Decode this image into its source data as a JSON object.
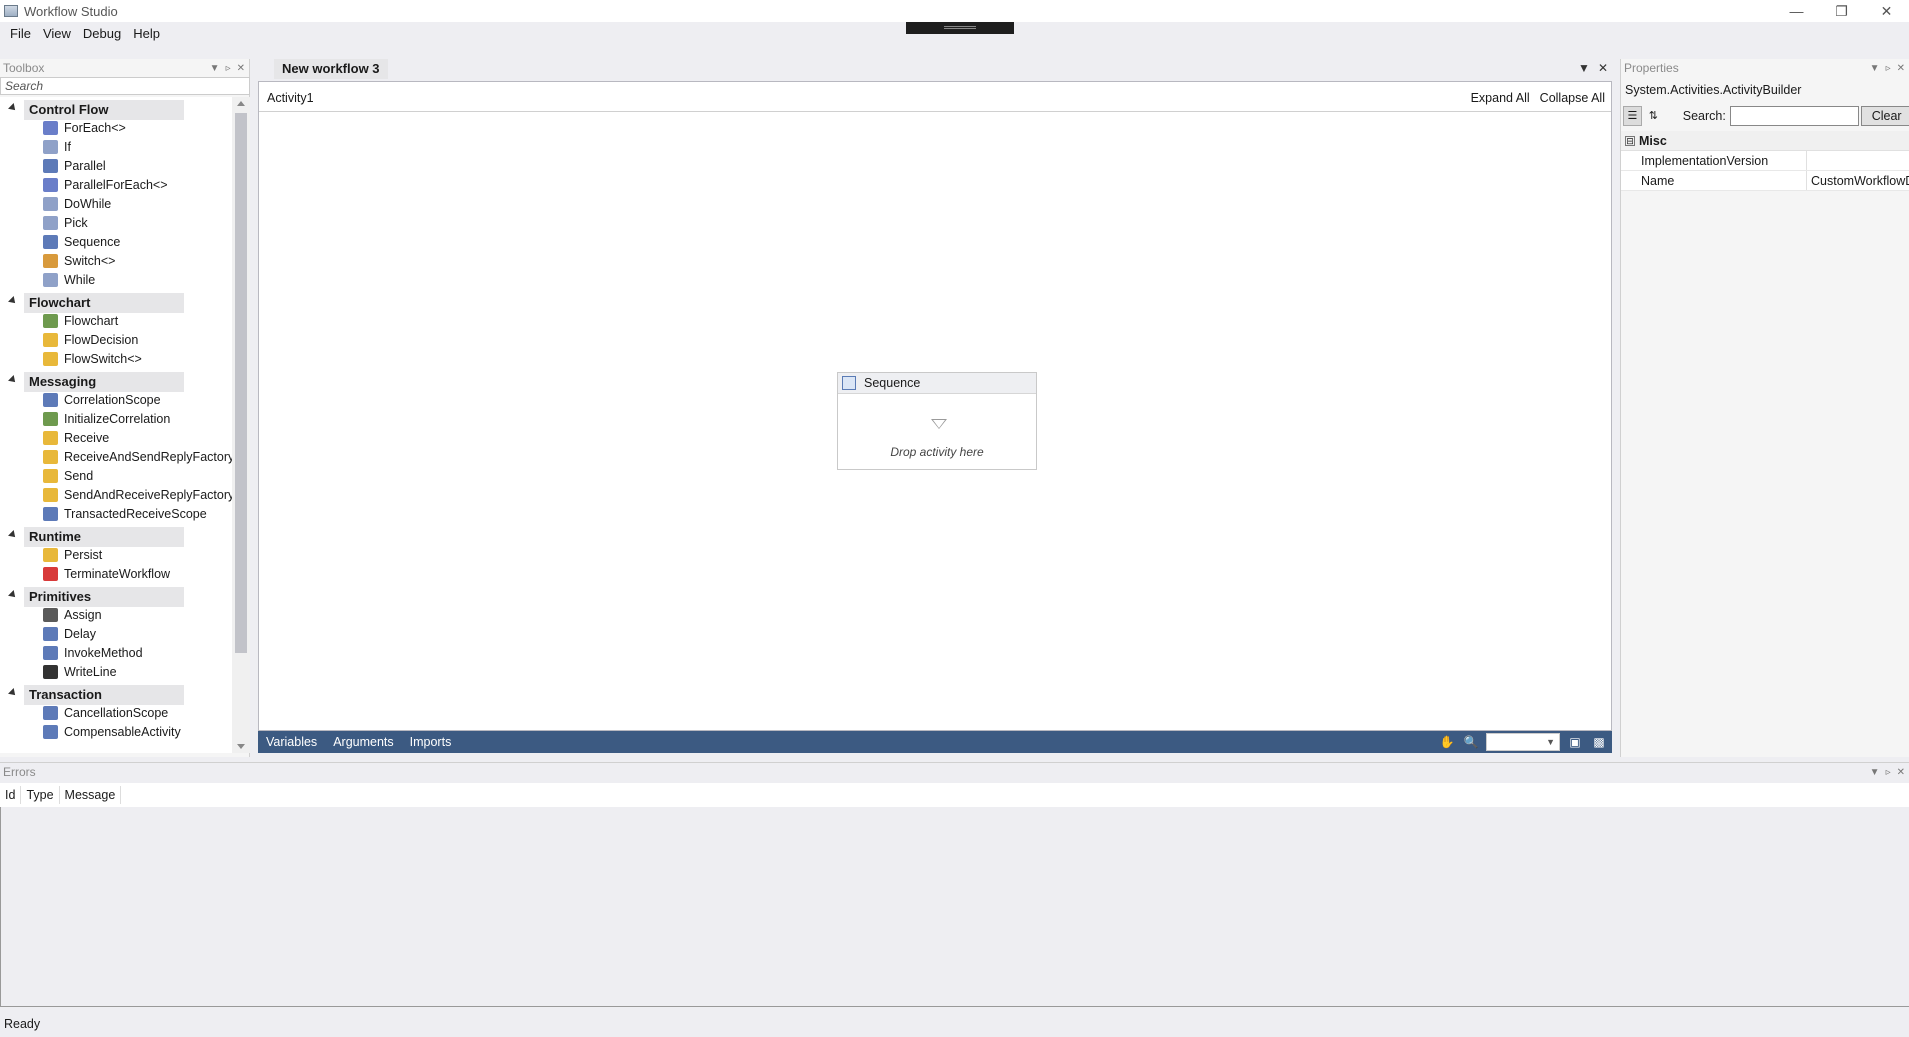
{
  "window": {
    "title": "Workflow Studio"
  },
  "menu": [
    "File",
    "View",
    "Debug",
    "Help"
  ],
  "toolbox": {
    "header": "Toolbox",
    "search_placeholder": "Search",
    "categories": [
      {
        "name": "Control Flow",
        "items": [
          {
            "label": "ForEach<>",
            "icon": "foreach-icon",
            "color": "#6a7ec9"
          },
          {
            "label": "If",
            "icon": "if-icon",
            "color": "#8fa1c8"
          },
          {
            "label": "Parallel",
            "icon": "parallel-icon",
            "color": "#5d7ab8"
          },
          {
            "label": "ParallelForEach<>",
            "icon": "parallel-foreach-icon",
            "color": "#6a7ec9"
          },
          {
            "label": "DoWhile",
            "icon": "dowhile-icon",
            "color": "#8fa1c8"
          },
          {
            "label": "Pick",
            "icon": "pick-icon",
            "color": "#8fa1c8"
          },
          {
            "label": "Sequence",
            "icon": "sequence-icon",
            "color": "#5d7ab8"
          },
          {
            "label": "Switch<>",
            "icon": "switch-icon",
            "color": "#d89a3c"
          },
          {
            "label": "While",
            "icon": "while-icon",
            "color": "#8fa1c8"
          }
        ]
      },
      {
        "name": "Flowchart",
        "items": [
          {
            "label": "Flowchart",
            "icon": "flowchart-icon",
            "color": "#6e9a4e"
          },
          {
            "label": "FlowDecision",
            "icon": "flowdecision-icon",
            "color": "#e8b83a"
          },
          {
            "label": "FlowSwitch<>",
            "icon": "flowswitch-icon",
            "color": "#e8b83a"
          }
        ]
      },
      {
        "name": "Messaging",
        "items": [
          {
            "label": "CorrelationScope",
            "icon": "correlation-scope-icon",
            "color": "#5d7ab8"
          },
          {
            "label": "InitializeCorrelation",
            "icon": "initialize-correlation-icon",
            "color": "#6e9a4e"
          },
          {
            "label": "Receive",
            "icon": "receive-icon",
            "color": "#e8b83a"
          },
          {
            "label": "ReceiveAndSendReplyFactory",
            "icon": "receive-send-reply-icon",
            "color": "#e8b83a"
          },
          {
            "label": "Send",
            "icon": "send-icon",
            "color": "#e8b83a"
          },
          {
            "label": "SendAndReceiveReplyFactory",
            "icon": "send-receive-reply-icon",
            "color": "#e8b83a"
          },
          {
            "label": "TransactedReceiveScope",
            "icon": "transacted-receive-scope-icon",
            "color": "#5d7ab8"
          }
        ]
      },
      {
        "name": "Runtime",
        "items": [
          {
            "label": "Persist",
            "icon": "persist-icon",
            "color": "#e8b83a"
          },
          {
            "label": "TerminateWorkflow",
            "icon": "terminate-workflow-icon",
            "color": "#d83a3a"
          }
        ]
      },
      {
        "name": "Primitives",
        "items": [
          {
            "label": "Assign",
            "icon": "assign-icon",
            "color": "#5a5a5a"
          },
          {
            "label": "Delay",
            "icon": "delay-icon",
            "color": "#5d7ab8"
          },
          {
            "label": "InvokeMethod",
            "icon": "invoke-method-icon",
            "color": "#5d7ab8"
          },
          {
            "label": "WriteLine",
            "icon": "writeline-icon",
            "color": "#333333"
          }
        ]
      },
      {
        "name": "Transaction",
        "items": [
          {
            "label": "CancellationScope",
            "icon": "cancellation-scope-icon",
            "color": "#5d7ab8"
          },
          {
            "label": "CompensableActivity",
            "icon": "compensable-activity-icon",
            "color": "#5d7ab8"
          }
        ]
      }
    ]
  },
  "designer": {
    "tab": "New workflow 3",
    "breadcrumb": "Activity1",
    "expand_all": "Expand All",
    "collapse_all": "Collapse All",
    "sequence": {
      "title": "Sequence",
      "drop_hint": "Drop activity here"
    },
    "footer_tabs": [
      "Variables",
      "Arguments",
      "Imports"
    ]
  },
  "properties": {
    "header": "Properties",
    "type": "System.Activities.ActivityBuilder",
    "search_label": "Search:",
    "clear": "Clear",
    "category": "Misc",
    "category_toggle": "⊟",
    "rows": [
      {
        "key": "ImplementationVersion",
        "value": ""
      },
      {
        "key": "Name",
        "value": "CustomWorkflowDe"
      }
    ]
  },
  "errors": {
    "header": "Errors",
    "columns": [
      "Id",
      "Type",
      "Message"
    ]
  },
  "status": "Ready"
}
